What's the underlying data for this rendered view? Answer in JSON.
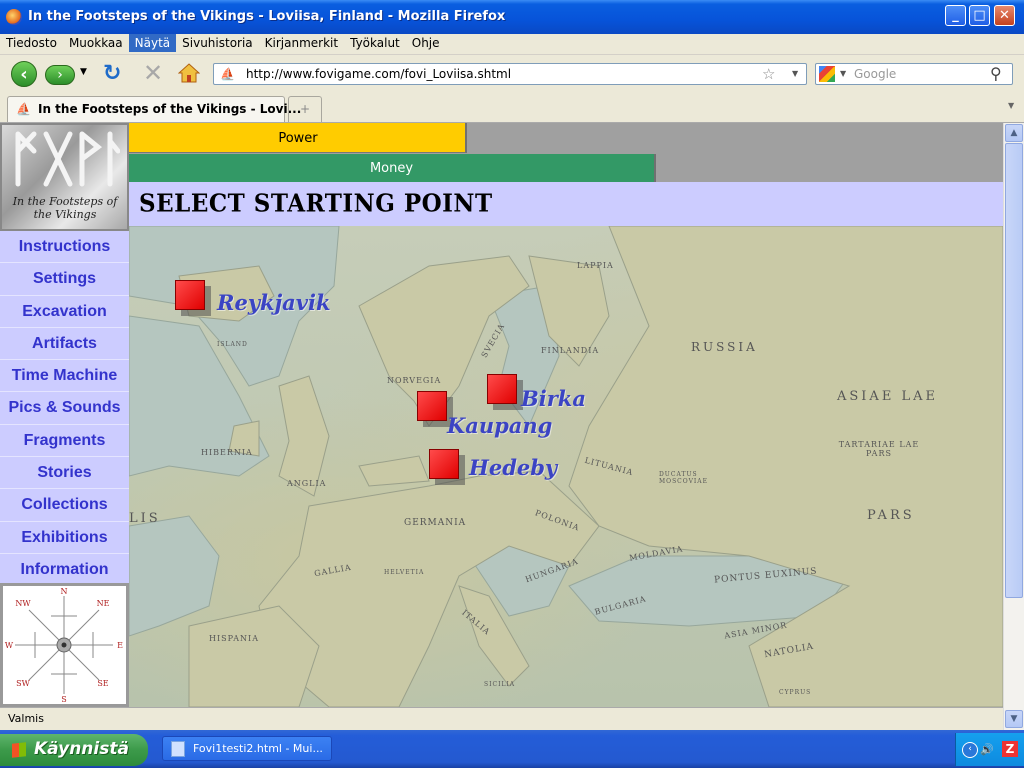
{
  "window": {
    "title": "In the Footsteps of the Vikings - Loviisa, Finland - Mozilla Firefox"
  },
  "menu": {
    "items": [
      "Tiedosto",
      "Muokkaa",
      "Näytä",
      "Sivuhistoria",
      "Kirjanmerkit",
      "Työkalut",
      "Ohje"
    ],
    "selected": "Näytä"
  },
  "navbar": {
    "url": "http://www.fovigame.com/fovi_Loviisa.shtml",
    "search_placeholder": "Google"
  },
  "tab": {
    "title": "In the Footsteps of the Vikings - Lovi...",
    "new_tab": "+"
  },
  "logo": {
    "text": "In the Footsteps of the Vikings"
  },
  "bars": {
    "power": {
      "label": "Power",
      "fraction": 0.385
    },
    "money": {
      "label": "Money",
      "fraction": 0.601
    }
  },
  "heading": "SELECT STARTING POINT",
  "sidebar": {
    "items": [
      "Instructions",
      "Settings",
      "Excavation",
      "Artifacts",
      "Time Machine",
      "Pics & Sounds",
      "Fragments",
      "Stories",
      "Collections",
      "Exhibitions",
      "Information"
    ]
  },
  "compass": {
    "n": "N",
    "s": "S",
    "e": "E",
    "w": "W",
    "nw": "NW",
    "ne": "NE",
    "sw": "SW",
    "se": "SE"
  },
  "map": {
    "cities": [
      "Reykjavik",
      "Birka",
      "Kaupang",
      "Hedeby"
    ],
    "labels": [
      "LAPPIA",
      "RUSSIA",
      "FINLANDIA",
      "SVECIA",
      "NORVEGIA",
      "HIBERNIA",
      "ANGLIA",
      "GERMANIA",
      "POLONIA",
      "LITUANIA",
      "GALLIA",
      "HELVETIA",
      "HISPANIA",
      "ITALIA",
      "HUNGARIA",
      "MOLDAVIA",
      "BULGARIA",
      "PONTUS EUXINUS",
      "ASIA MINOR",
      "NATOLIA",
      "TARTARIAE LAE PARS",
      "PARS",
      "ASIAE LAE",
      "DUCATUS MOSCOVIAE",
      "ISLAND",
      "LIS",
      "CYPRUS",
      "SICILIA"
    ]
  },
  "status": "Valmis",
  "taskbar": {
    "start": "Käynnistä",
    "item": "Fovi1testi2.html - Mui..."
  }
}
